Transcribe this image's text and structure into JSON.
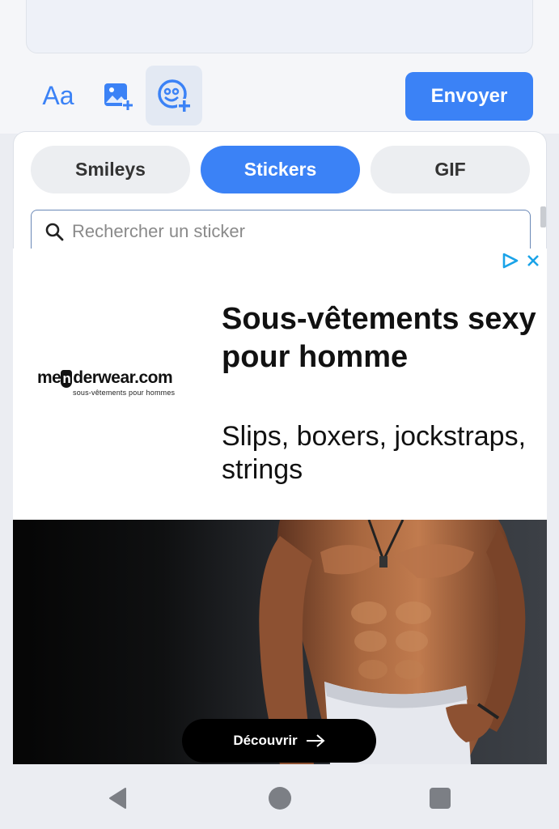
{
  "composer": {
    "font_tool_label": "Aa",
    "send_label": "Envoyer"
  },
  "picker": {
    "tabs": [
      {
        "label": "Smileys",
        "active": false
      },
      {
        "label": "Stickers",
        "active": true
      },
      {
        "label": "GIF",
        "active": false
      }
    ],
    "search_placeholder": "Rechercher un sticker"
  },
  "ad": {
    "brand_prefix": "me",
    "brand_box": "n",
    "brand_suffix": "derwear.com",
    "brand_tagline": "sous-vêtements pour hommes",
    "headline": "Sous-vêtements sexy pour homme",
    "subtext": "Slips, boxers, jockstraps, strings",
    "cta_label": "Découvrir"
  },
  "colors": {
    "accent": "#3b82f6",
    "adchoices": "#1aa3e8"
  },
  "icons": [
    "font-icon",
    "image-add-icon",
    "sticker-add-icon",
    "search-icon",
    "adchoices-icon",
    "close-icon",
    "arrow-right-icon",
    "back-icon",
    "home-icon",
    "recents-icon"
  ]
}
